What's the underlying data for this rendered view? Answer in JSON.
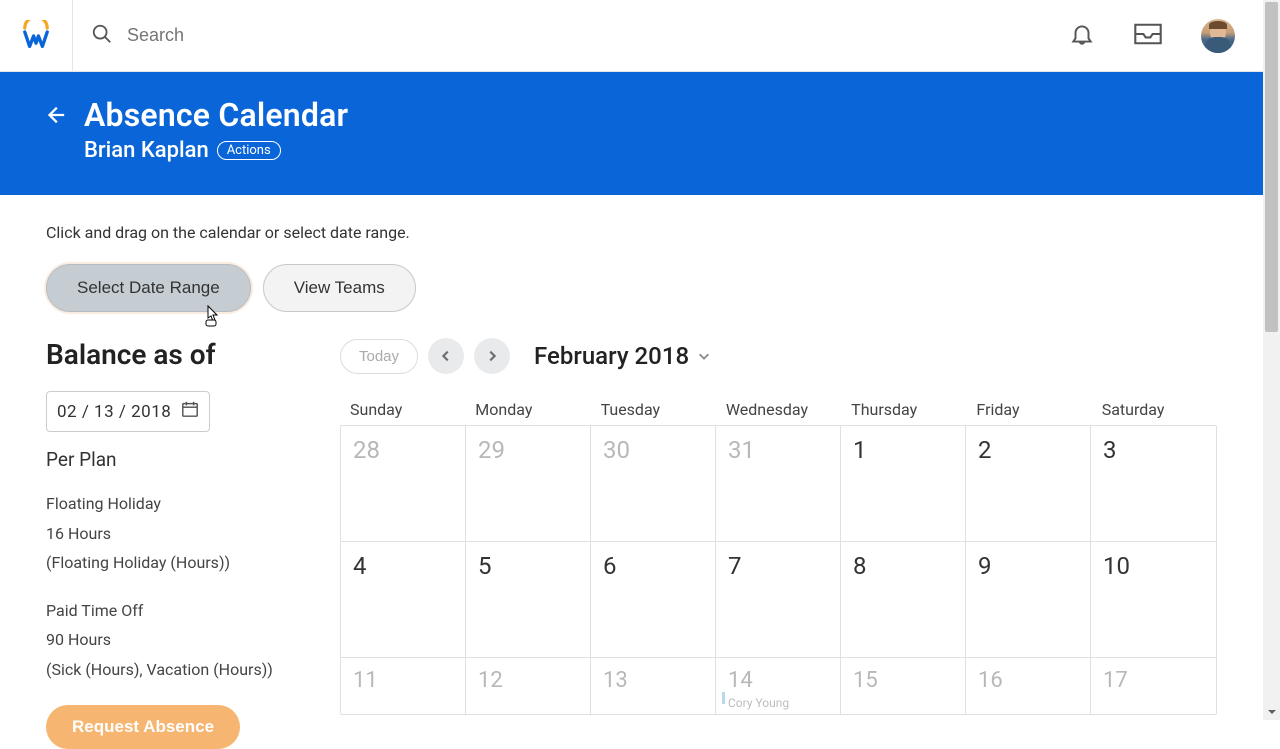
{
  "topbar": {
    "search_placeholder": "Search"
  },
  "header": {
    "title": "Absence Calendar",
    "person": "Brian Kaplan",
    "actions_label": "Actions"
  },
  "hint": "Click and drag on the calendar or select date range.",
  "buttons": {
    "select_date_range": "Select Date Range",
    "view_teams": "View Teams"
  },
  "balance": {
    "title": "Balance as of",
    "date": "02 / 13 / 2018",
    "per_plan": "Per Plan",
    "plans": [
      {
        "name": "Floating Holiday",
        "amount": "16 Hours",
        "detail": "(Floating Holiday (Hours))"
      },
      {
        "name": "Paid Time Off",
        "amount": "90 Hours",
        "detail": "(Sick (Hours), Vacation (Hours))"
      }
    ],
    "request_absence": "Request Absence"
  },
  "calendar": {
    "today": "Today",
    "month": "February 2018",
    "day_names": [
      "Sunday",
      "Monday",
      "Tuesday",
      "Wednesday",
      "Thursday",
      "Friday",
      "Saturday"
    ],
    "rows": [
      {
        "cells": [
          {
            "n": "28",
            "prev": true
          },
          {
            "n": "29",
            "prev": true
          },
          {
            "n": "30",
            "prev": true
          },
          {
            "n": "31",
            "prev": true
          },
          {
            "n": "1"
          },
          {
            "n": "2"
          },
          {
            "n": "3"
          }
        ]
      },
      {
        "cells": [
          {
            "n": "4"
          },
          {
            "n": "5"
          },
          {
            "n": "6"
          },
          {
            "n": "7"
          },
          {
            "n": "8"
          },
          {
            "n": "9"
          },
          {
            "n": "10"
          }
        ]
      },
      {
        "short": true,
        "cells": [
          {
            "n": "11"
          },
          {
            "n": "12"
          },
          {
            "n": "13"
          },
          {
            "n": "14",
            "evt": "Cory Young",
            "bar": true
          },
          {
            "n": "15"
          },
          {
            "n": "16"
          },
          {
            "n": "17"
          }
        ]
      }
    ]
  }
}
